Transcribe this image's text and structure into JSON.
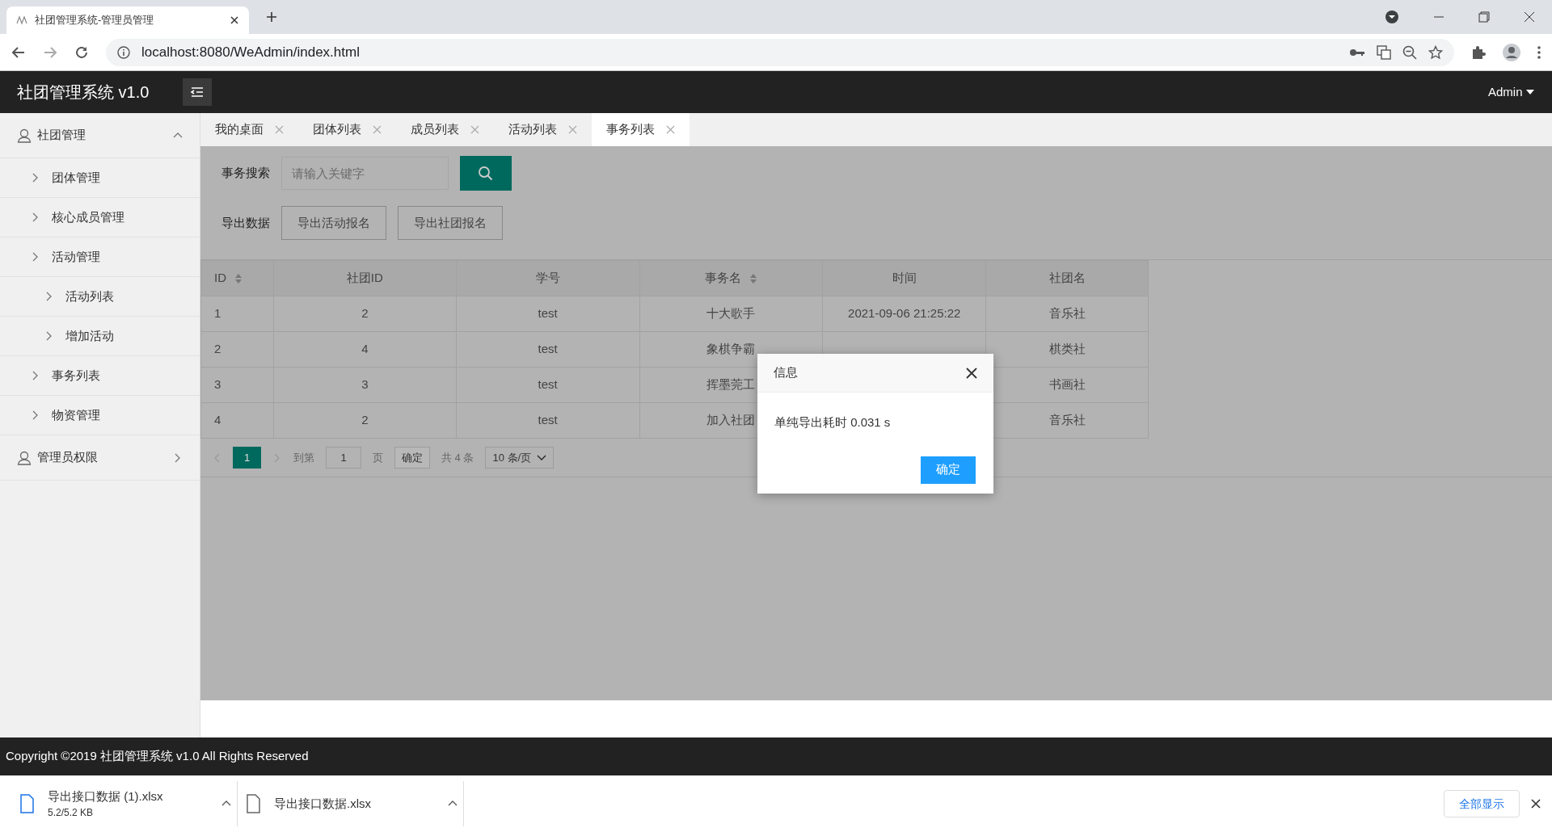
{
  "browser": {
    "tab_title": "社团管理系统-管理员管理",
    "url": "localhost:8080/WeAdmin/index.html"
  },
  "app": {
    "title": "社团管理系统 v1.0",
    "user": "Admin"
  },
  "sidebar": {
    "items": [
      {
        "label": "社团管理",
        "expanded": true,
        "children": [
          {
            "label": "团体管理"
          },
          {
            "label": "核心成员管理"
          },
          {
            "label": "活动管理",
            "children": [
              {
                "label": "活动列表"
              },
              {
                "label": "增加活动"
              }
            ]
          },
          {
            "label": "事务列表"
          },
          {
            "label": "物资管理"
          }
        ]
      },
      {
        "label": "管理员权限",
        "expanded": false
      }
    ]
  },
  "tabs": [
    {
      "label": "我的桌面",
      "selected": false
    },
    {
      "label": "团体列表",
      "selected": false
    },
    {
      "label": "成员列表",
      "selected": false
    },
    {
      "label": "活动列表",
      "selected": false
    },
    {
      "label": "事务列表",
      "selected": true
    }
  ],
  "search": {
    "label": "事务搜索",
    "placeholder": "请输入关键字"
  },
  "export": {
    "label": "导出数据",
    "buttons": [
      "导出活动报名",
      "导出社团报名"
    ]
  },
  "table": {
    "columns": [
      {
        "label": "ID",
        "sortable": true
      },
      {
        "label": "社团ID",
        "sortable": false
      },
      {
        "label": "学号",
        "sortable": false
      },
      {
        "label": "事务名",
        "sortable": true
      },
      {
        "label": "时间",
        "sortable": false
      },
      {
        "label": "社团名",
        "sortable": false
      }
    ],
    "rows": [
      [
        "1",
        "2",
        "test",
        "十大歌手",
        "2021-09-06 21:25:22",
        "音乐社"
      ],
      [
        "2",
        "4",
        "test",
        "象棋争霸",
        null,
        "棋类社"
      ],
      [
        "3",
        "3",
        "test",
        "挥墨莞工",
        null,
        "书画社"
      ],
      [
        "4",
        "2",
        "test",
        "加入社团",
        null,
        "音乐社"
      ]
    ]
  },
  "pagination": {
    "current": "1",
    "goto_label": "到第",
    "goto_value": "1",
    "page_unit": "页",
    "confirm": "确定",
    "total": "共 4 条",
    "page_size": "10 条/页"
  },
  "dialog": {
    "title": "信息",
    "message": "单纯导出耗时 0.031 s",
    "button": "确定"
  },
  "footer": {
    "text": "Copyright ©2019 社团管理系统 v1.0 All Rights Reserved"
  },
  "downloads": {
    "items": [
      {
        "name": "导出接口数据 (1).xlsx",
        "detail": "5.2/5.2 KB"
      },
      {
        "name": "导出接口数据.xlsx"
      }
    ],
    "show_all": "全部显示"
  }
}
